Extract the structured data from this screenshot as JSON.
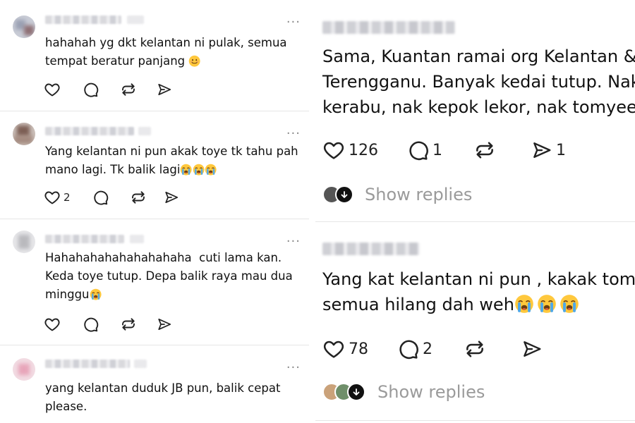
{
  "left_comments": [
    {
      "text": "hahahah yg dkt kelantan ni pulak, semua tempat beratur panjang",
      "emoji": "smiling-face",
      "likes": "",
      "replies": ""
    },
    {
      "text": "Yang kelantan ni pun akak toye tk tahu pah mano lagi. Tk balik lagi",
      "emoji": "loudly-crying-face x3",
      "likes": "2",
      "replies": ""
    },
    {
      "text": "Hahahahahahahahahaha  cuti lama kan. Keda toye tutup. Depa balik raya mau dua minggu",
      "emoji": "loudly-crying-face",
      "likes": "",
      "replies": ""
    },
    {
      "text": "yang kelantan duduk JB pun, balik cepat please.",
      "emoji": "",
      "likes": "",
      "replies": ""
    }
  ],
  "right_comments": [
    {
      "line1": "Sama, Kuantan ramai org Kelantan &",
      "line2": "Terengganu. Banyak kedai tutup. Nak",
      "line3": "kerabu, nak kepok lekor, nak tomyeeeem",
      "likes": "126",
      "replies": "1",
      "reposts": "",
      "shares": "1",
      "show_replies": "Show replies"
    },
    {
      "line1": "Yang kat kelantan ni pun , kakak tomyam",
      "line2": "semua hilang dah weh",
      "emoji": "loudly-crying-face x3",
      "likes": "78",
      "replies": "2",
      "reposts": "",
      "shares": "",
      "show_replies": "Show replies"
    }
  ],
  "icons": [
    "heart-icon",
    "comment-icon",
    "repost-icon",
    "share-icon",
    "more-options-icon",
    "loudly-crying-face-emoji",
    "smiling-face-emoji"
  ],
  "colors": {
    "text": "#111111",
    "muted": "#9a9a9a",
    "divider": "#e6e6e6",
    "background": "#ffffff"
  }
}
